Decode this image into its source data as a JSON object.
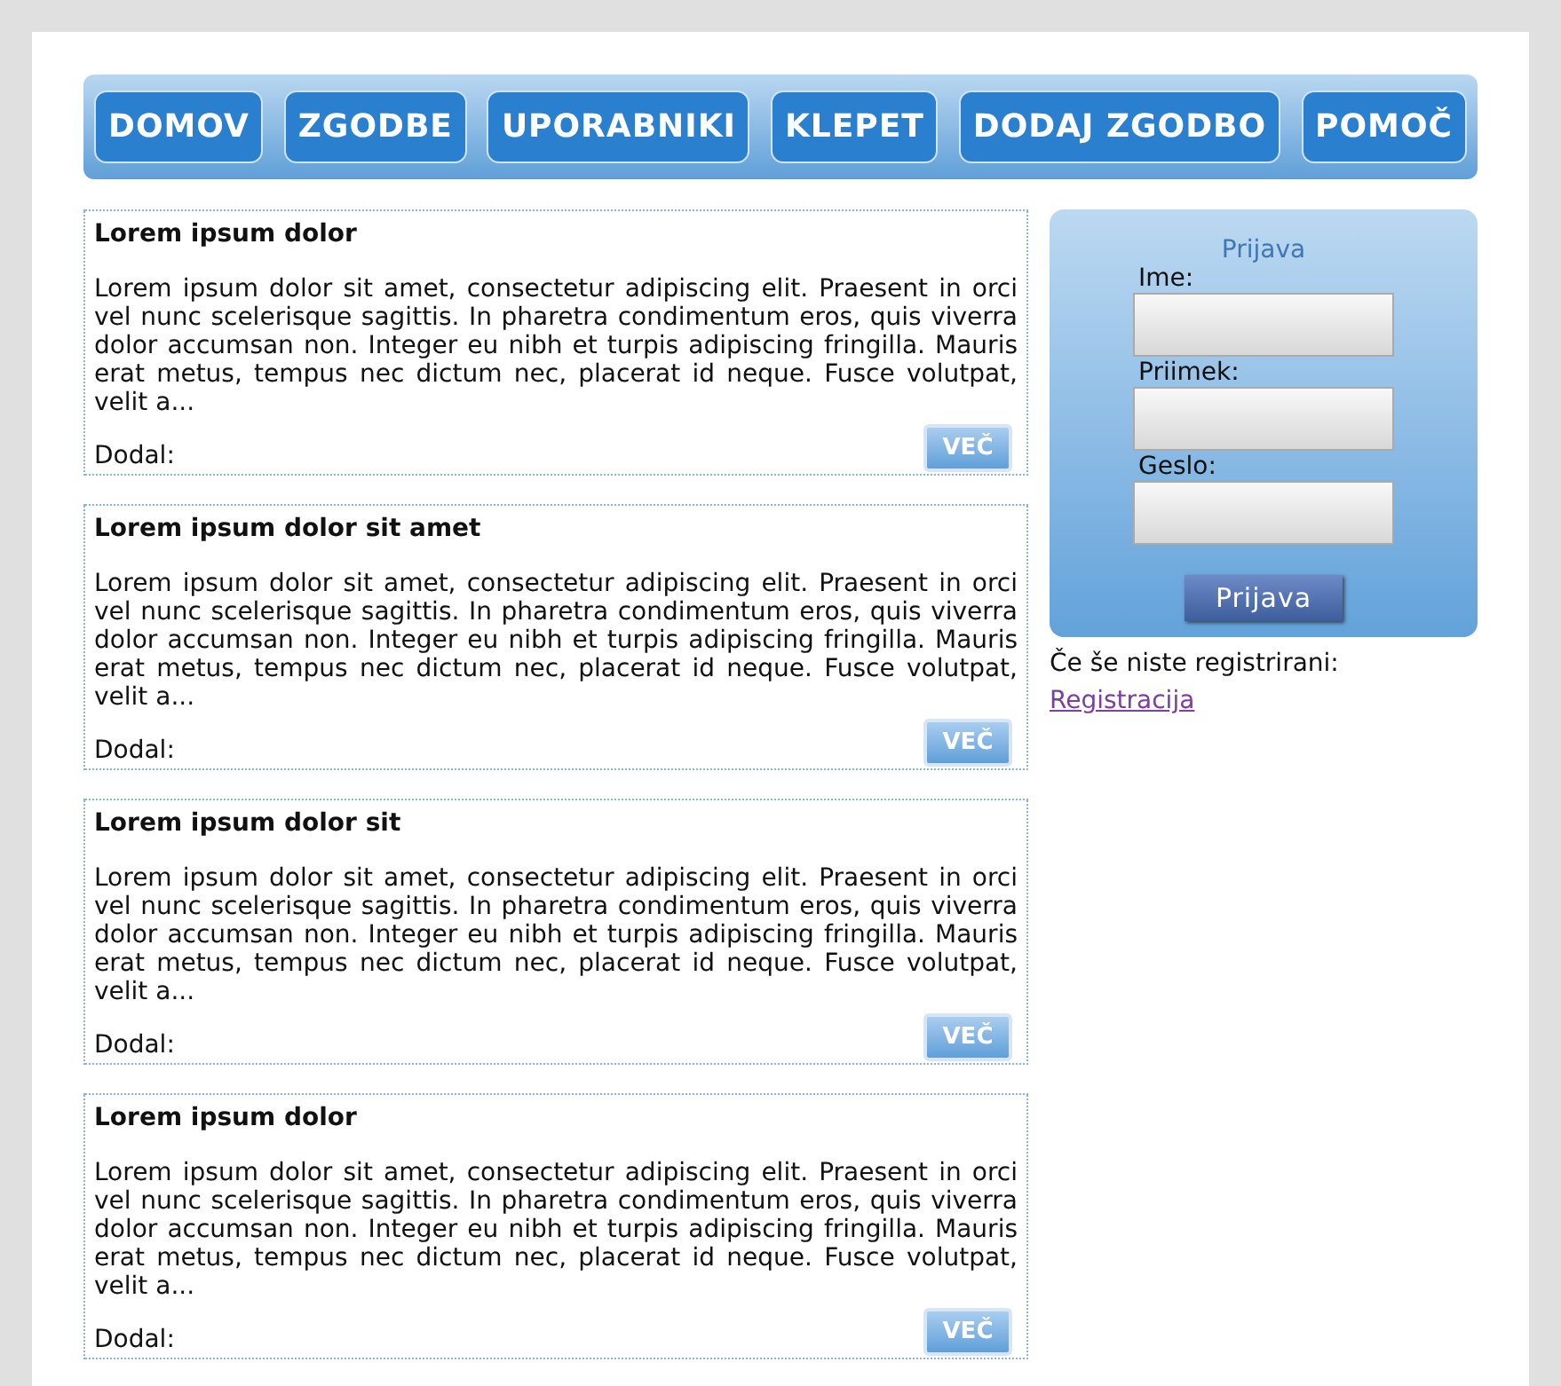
{
  "nav": [
    {
      "label": "DOMOV"
    },
    {
      "label": "ZGODBE"
    },
    {
      "label": "UPORABNIKI"
    },
    {
      "label": "KLEPET"
    },
    {
      "label": "DODAJ ZGODBO"
    },
    {
      "label": "POMOČ"
    }
  ],
  "posts": [
    {
      "title": "Lorem ipsum dolor",
      "body": "Lorem ipsum dolor sit amet, consectetur adipiscing elit. Praesent in orci vel nunc scelerisque sagittis. In pharetra condimentum eros, quis viverra dolor accumsan non. Integer eu nibh et turpis adipiscing fringilla. Mauris erat metus, tempus nec dictum nec, placerat id neque. Fusce volutpat, velit a...",
      "author_label": "Dodal:",
      "button": "VEČ"
    },
    {
      "title": "Lorem ipsum dolor sit amet",
      "body": "Lorem ipsum dolor sit amet, consectetur adipiscing elit. Praesent in orci vel nunc scelerisque sagittis. In pharetra condimentum eros, quis viverra dolor accumsan non. Integer eu nibh et turpis adipiscing fringilla. Mauris erat metus, tempus nec dictum nec, placerat id neque. Fusce volutpat, velit a...",
      "author_label": "Dodal:",
      "button": "VEČ"
    },
    {
      "title": "Lorem ipsum dolor sit",
      "body": "Lorem ipsum dolor sit amet, consectetur adipiscing elit. Praesent in orci vel nunc scelerisque sagittis. In pharetra condimentum eros, quis viverra dolor accumsan non. Integer eu nibh et turpis adipiscing fringilla. Mauris erat metus, tempus nec dictum nec, placerat id neque. Fusce volutpat, velit a...",
      "author_label": "Dodal:",
      "button": "VEČ"
    },
    {
      "title": "Lorem ipsum dolor",
      "body": "Lorem ipsum dolor sit amet, consectetur adipiscing elit. Praesent in orci vel nunc scelerisque sagittis. In pharetra condimentum eros, quis viverra dolor accumsan non. Integer eu nibh et turpis adipiscing fringilla. Mauris erat metus, tempus nec dictum nec, placerat id neque. Fusce volutpat, velit a...",
      "author_label": "Dodal:",
      "button": "VEČ"
    }
  ],
  "login": {
    "title": "Prijava",
    "fields": [
      {
        "label": "Ime:"
      },
      {
        "label": "Priimek:"
      },
      {
        "label": "Geslo:"
      }
    ],
    "button": "Prijava"
  },
  "register": {
    "text": "Če še niste registrirani:",
    "link": "Registracija"
  }
}
